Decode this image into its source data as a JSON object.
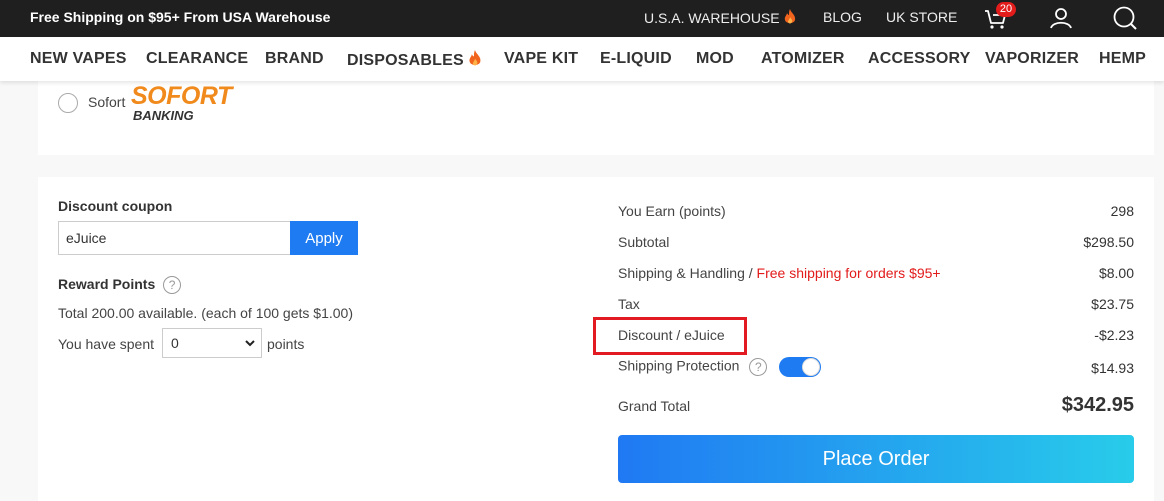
{
  "topbar": {
    "promo": "Free Shipping on $95+ From USA Warehouse",
    "links": [
      "U.S.A. WAREHOUSE",
      "BLOG",
      "UK STORE"
    ],
    "cart_count": "20",
    "icons": [
      "cart-icon",
      "user-icon",
      "search-icon"
    ]
  },
  "nav": {
    "items": [
      "NEW VAPES",
      "CLEARANCE",
      "BRAND",
      "DISPOSABLES",
      "VAPE KIT",
      "E-LIQUID",
      "MOD",
      "ATOMIZER",
      "ACCESSORY",
      "VAPORIZER",
      "HEMP"
    ]
  },
  "payment": {
    "option_label": "Sofort",
    "logo_top": "SOFORT",
    "logo_bottom": "BANKING"
  },
  "coupon": {
    "title": "Discount coupon",
    "value": "eJuice",
    "apply_label": "Apply"
  },
  "rewards": {
    "title": "Reward Points",
    "help": "?",
    "available_text": "Total 200.00 available. (each of 100 gets $1.00)",
    "spent_prefix": "You have spent",
    "spent_value": "0",
    "spent_suffix": "points"
  },
  "summary": {
    "earn_label": "You Earn (points)",
    "earn_value": "298",
    "subtotal_label": "Subtotal",
    "subtotal_value": "$298.50",
    "shipping_label": "Shipping & Handling / ",
    "shipping_note": "Free shipping for orders $95+",
    "shipping_value": "$8.00",
    "tax_label": "Tax",
    "tax_value": "$23.75",
    "discount_label": "Discount / eJuice",
    "discount_value": "-$2.23",
    "protection_label": "Shipping Protection",
    "protection_help": "?",
    "protection_enabled": true,
    "protection_value": "$14.93",
    "grand_label": "Grand Total",
    "grand_value": "$342.95",
    "place_order_label": "Place Order"
  },
  "colors": {
    "accent_blue": "#1f7bf1",
    "price_red": "#e21b1b",
    "highlight_red": "#e21b23",
    "sofort_orange": "#f18a1c"
  }
}
